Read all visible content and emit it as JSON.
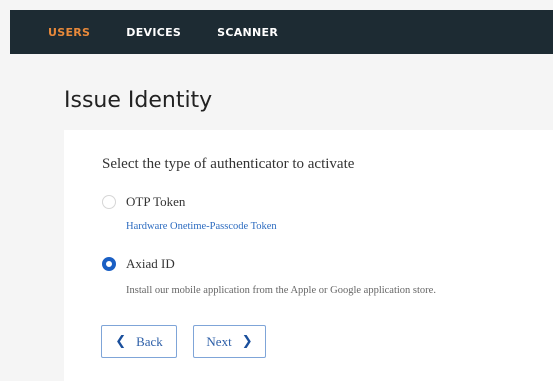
{
  "nav": {
    "tabs": [
      {
        "label": "USERS",
        "active": true
      },
      {
        "label": "DEVICES",
        "active": false
      },
      {
        "label": "SCANNER",
        "active": false
      }
    ]
  },
  "page": {
    "title": "Issue Identity"
  },
  "form": {
    "question": "Select the type of authenticator to activate",
    "options": [
      {
        "label": "OTP Token",
        "description": "Hardware Onetime-Passcode Token",
        "selected": false
      },
      {
        "label": "Axiad ID",
        "description": "Install our mobile application from the Apple or Google application store.",
        "selected": true
      }
    ]
  },
  "buttons": {
    "back": {
      "label": "Back",
      "icon": "chevron-left-icon"
    },
    "next": {
      "label": "Next",
      "icon": "chevron-right-icon"
    }
  },
  "colors": {
    "nav_background": "#1d2b33",
    "active_tab": "#e8893a",
    "accent": "#1a5fc4"
  }
}
